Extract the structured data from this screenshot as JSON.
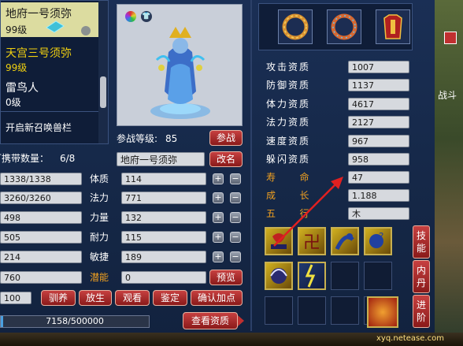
{
  "summon_list": [
    {
      "name": "地府一号须弥",
      "level": "99级",
      "selected": true
    },
    {
      "name": "天宫三号须弥",
      "level": "99级",
      "selected": false
    },
    {
      "name": "雷鸟人",
      "level": "0级",
      "selected": false
    }
  ],
  "open_slot_label": "开启新召唤兽栏",
  "carry_count_label": "可携带数量：",
  "carry_count_value": "6/8",
  "battle_level_label": "参战等级:",
  "battle_level_value": "85",
  "battle_button": "参战",
  "pet_name_value": "地府一号须弥",
  "rename_button": "改名",
  "hp": "1338/1338",
  "mp": "3260/3260",
  "atk": "498",
  "def": "505",
  "spd": "214",
  "lingli": "760",
  "loyalty": "100",
  "attributes": [
    {
      "label": "体质",
      "value": "114"
    },
    {
      "label": "法力",
      "value": "771"
    },
    {
      "label": "力量",
      "value": "132"
    },
    {
      "label": "耐力",
      "value": "115"
    },
    {
      "label": "敏捷",
      "value": "189"
    }
  ],
  "potential_label": "潜能",
  "potential_value": "0",
  "preview_button": "预览",
  "action_buttons": [
    "驯养",
    "放生",
    "观看",
    "鉴定",
    "确认加点"
  ],
  "exp_value": "7158/500000",
  "view_quality_button": "查看资质",
  "aptitudes": [
    {
      "label": "攻击资质",
      "value": "1007"
    },
    {
      "label": "防御资质",
      "value": "1137"
    },
    {
      "label": "体力资质",
      "value": "4617"
    },
    {
      "label": "法力资质",
      "value": "2127"
    },
    {
      "label": "速度资质",
      "value": "967"
    },
    {
      "label": "躲闪资质",
      "value": "958"
    }
  ],
  "lifespan_label": "寿        命",
  "lifespan_value": "47",
  "growth_label": "成        长",
  "growth_value": "1.188",
  "element_label": "五        行",
  "element_value": "木",
  "side_tabs": [
    "技能",
    "内丹",
    "进阶"
  ],
  "corner_text_1": "战斗",
  "watermark": "xyq.netease.com",
  "colors": {
    "accent": "#f0a020",
    "button": "#b03030",
    "arrow": "#e02020"
  }
}
